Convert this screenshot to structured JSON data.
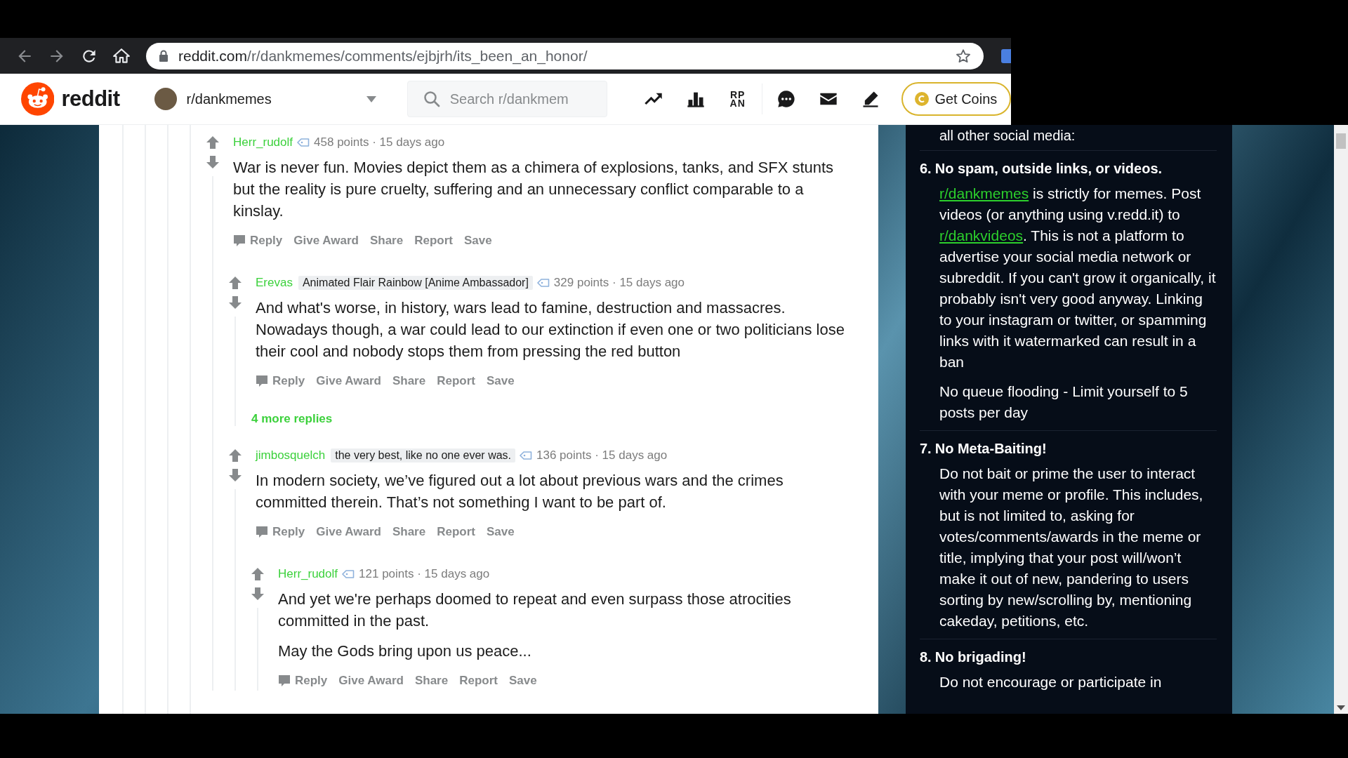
{
  "browser": {
    "url_host": "reddit.com",
    "url_path": "/r/dankmemes/comments/ejbjrh/its_been_an_honor/"
  },
  "header": {
    "wordmark": "reddit",
    "subreddit": "r/dankmemes",
    "search": {
      "placeholder": "Search r/dankmem"
    },
    "rpan_label": [
      "RP",
      "AN"
    ],
    "coins_button": "Get Coins"
  },
  "comments": [
    {
      "author": "Herr_rudolf",
      "meta": "458 points · 15 days ago",
      "paragraphs": [
        "War is never fun. Movies depict them as a chimera of explosions, tanks, and SFX stunts but the reality is pure cruelty, suffering and an unnecessary conflict comparable to a kinslay."
      ],
      "actions": [
        "Reply",
        "Give Award",
        "Share",
        "Report",
        "Save"
      ],
      "children": [
        {
          "author": "Erevas",
          "flair": "Animated Flair Rainbow [Anime Ambassador]",
          "meta": "329 points · 15 days ago",
          "paragraphs": [
            "And what's worse, in history, wars lead to famine, destruction and massacres. Nowadays though, a war could lead to our extinction if even one or two politicians lose their cool and nobody stops them from pressing the red button"
          ],
          "actions": [
            "Reply",
            "Give Award",
            "Share",
            "Report",
            "Save"
          ],
          "more_replies": "4 more replies"
        },
        {
          "author": "jimbosquelch",
          "flair": "the very best, like no one ever was.",
          "meta": "136 points · 15 days ago",
          "paragraphs": [
            "In modern society, we’ve figured out a lot about previous wars and the crimes committed therein. That’s not something I want to be part of."
          ],
          "actions": [
            "Reply",
            "Give Award",
            "Share",
            "Report",
            "Save"
          ],
          "children": [
            {
              "author": "Herr_rudolf",
              "meta": "121 points · 15 days ago",
              "paragraphs": [
                "And yet we're perhaps doomed to repeat and even surpass those atrocities committed in the past.",
                "May the Gods bring upon us peace..."
              ],
              "actions": [
                "Reply",
                "Give Award",
                "Share",
                "Report",
                "Save"
              ]
            }
          ]
        }
      ]
    }
  ],
  "sidebar": {
    "cut_text_top": "all other social media:",
    "rules": [
      {
        "number": "6.",
        "title": "No spam, outside links, or videos.",
        "paragraphs": [
          [
            {
              "kind": "link",
              "text": "r/dankmemes"
            },
            {
              "kind": "plain",
              "text": " is strictly for memes. Post videos (or anything using v.redd.it) to "
            },
            {
              "kind": "link",
              "text": "r/dankvideos"
            },
            {
              "kind": "plain",
              "text": ". This is not a platform to advertise your social media network or subreddit. If you can't grow it organically, it probably isn't very good anyway. Linking to your instagram or twitter, or spamming links with it watermarked can result in a ban"
            }
          ],
          [
            {
              "kind": "plain",
              "text": "No queue flooding - Limit yourself to 5 posts per day"
            }
          ]
        ]
      },
      {
        "number": "7.",
        "title": "No Meta-Baiting!",
        "paragraphs": [
          [
            {
              "kind": "plain",
              "text": "Do not bait or prime the user to interact with your meme or profile. This includes, but is not limited to, asking for votes/comments/awards in the meme or title, implying that your post will/won’t make it out of new, pandering to users sorting by new/scrolling by, mentioning cakeday, petitions, etc."
            }
          ]
        ]
      },
      {
        "number": "8.",
        "title": "No brigading!",
        "paragraphs": [
          [
            {
              "kind": "plain",
              "text": "Do not encourage or participate in"
            }
          ]
        ]
      }
    ]
  }
}
